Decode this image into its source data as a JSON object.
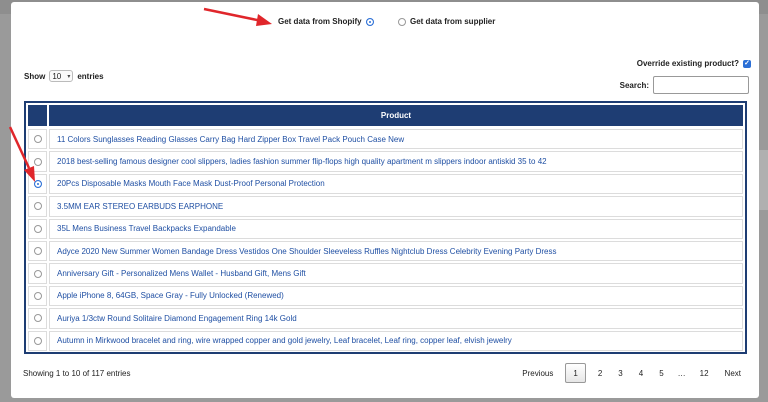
{
  "source_options": [
    {
      "label": "Get data from Shopify",
      "selected": true
    },
    {
      "label": "Get data from supplier",
      "selected": false
    }
  ],
  "override": {
    "label": "Override existing product?",
    "checked": true
  },
  "length": {
    "show": "Show",
    "value": "10",
    "entries": "entries"
  },
  "search": {
    "label": "Search:",
    "value": ""
  },
  "table": {
    "header": "Product",
    "rows": [
      {
        "name": "11 Colors Sunglasses Reading Glasses Carry Bag Hard Zipper Box Travel Pack Pouch Case New",
        "selected": false
      },
      {
        "name": "2018 best-selling famous designer cool slippers, ladies fashion summer flip-flops high quality apartment m slippers indoor antiskid 35 to 42",
        "selected": false
      },
      {
        "name": "20Pcs Disposable Masks Mouth Face Mask Dust-Proof Personal Protection",
        "selected": true
      },
      {
        "name": "3.5MM EAR STEREO EARBUDS EARPHONE",
        "selected": false
      },
      {
        "name": "35L Mens Business Travel Backpacks Expandable",
        "selected": false
      },
      {
        "name": "Adyce 2020 New Summer Women Bandage Dress Vestidos One Shoulder Sleeveless Ruffles Nightclub Dress Celebrity Evening Party Dress",
        "selected": false
      },
      {
        "name": "Anniversary Gift - Personalized Mens Wallet - Husband Gift, Mens Gift",
        "selected": false
      },
      {
        "name": "Apple iPhone 8, 64GB, Space Gray - Fully Unlocked (Renewed)",
        "selected": false
      },
      {
        "name": "Auriya 1/3ctw Round Solitaire Diamond Engagement Ring 14k Gold",
        "selected": false
      },
      {
        "name": "Autumn in Mirkwood bracelet and ring, wire wrapped copper and gold jewelry, Leaf bracelet, Leaf ring, copper leaf, elvish jewelry",
        "selected": false
      }
    ]
  },
  "info": "Showing 1 to 10 of 117 entries",
  "pagination": {
    "previous": "Previous",
    "pages": [
      "1",
      "2",
      "3",
      "4",
      "5",
      "…",
      "12"
    ],
    "current": "1",
    "next": "Next"
  },
  "colors": {
    "header": "#1e3d73",
    "accent": "#2b6fd6",
    "link": "#1f4fa3",
    "annotation_arrow": "#e0262b"
  },
  "icons": {
    "selected_radio": "radio-checked-icon",
    "unselected_radio": "radio-unchecked-icon",
    "checkbox": "checkbox-checked-icon",
    "annotation": "red-arrow-icon"
  }
}
